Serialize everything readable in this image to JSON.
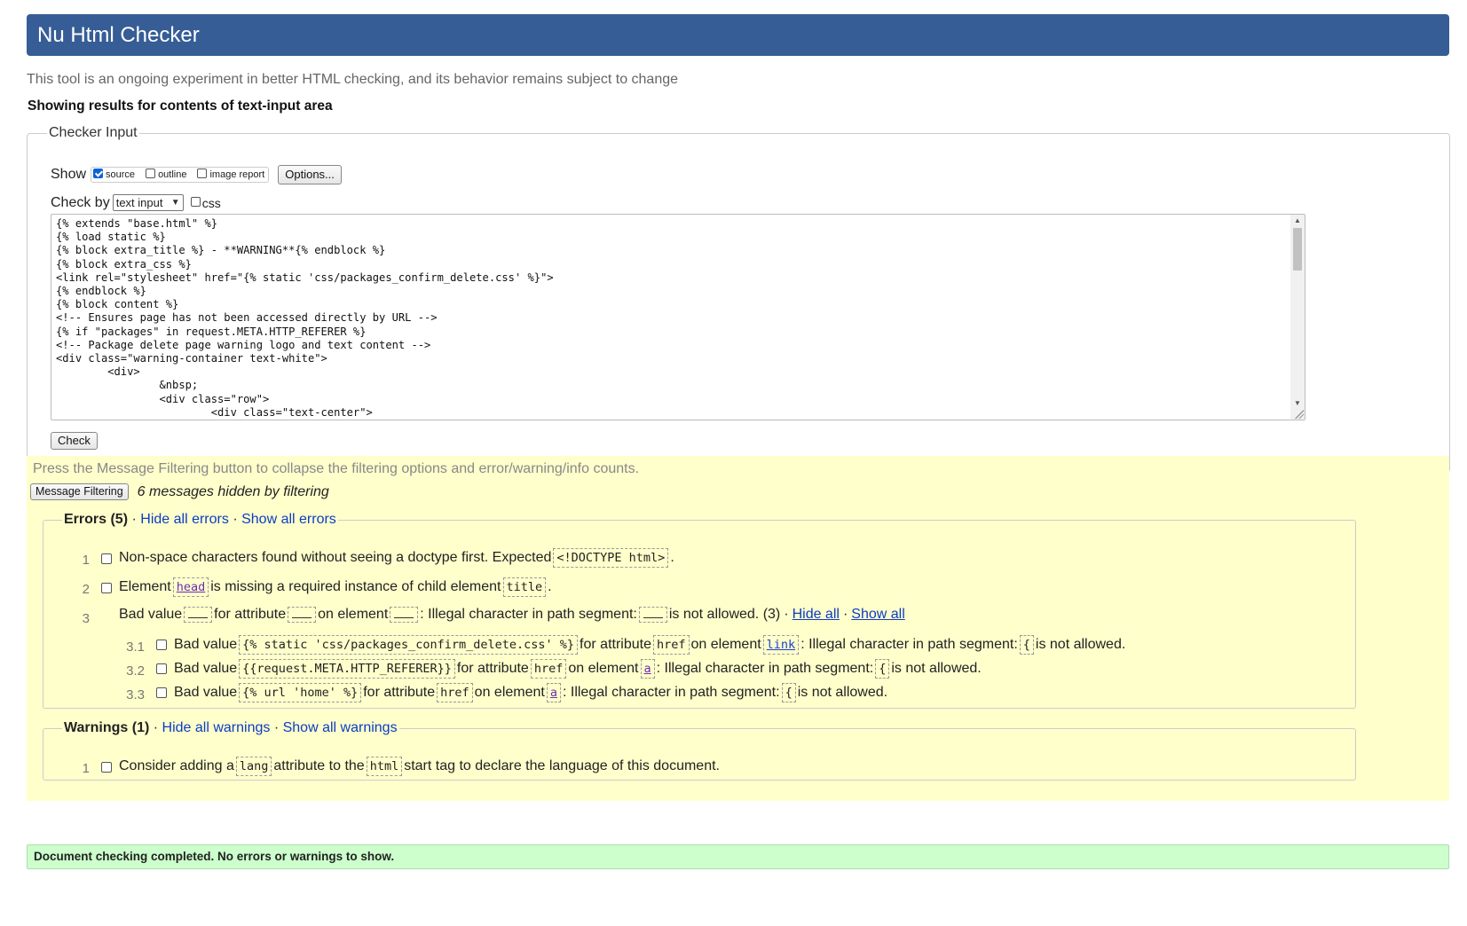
{
  "header": {
    "title": "Nu Html Checker"
  },
  "intro": "This tool is an ongoing experiment in better HTML checking, and its behavior remains subject to change",
  "showing": "Showing results for contents of text-input area",
  "checker_input": {
    "legend": "Checker Input",
    "show_label": "Show",
    "show_options": [
      "source",
      "outline",
      "image report"
    ],
    "options_button": "Options...",
    "check_by_label": "Check by",
    "check_by_value": "text input",
    "css_label": "css",
    "source_text": "{% extends \"base.html\" %}\n{% load static %}\n{% block extra_title %} - **WARNING**{% endblock %}\n{% block extra_css %}\n<link rel=\"stylesheet\" href=\"{% static 'css/packages_confirm_delete.css' %}\">\n{% endblock %}\n{% block content %}\n<!-- Ensures page has not been accessed directly by URL -->\n{% if \"packages\" in request.META.HTTP_REFERER %}\n<!-- Package delete page warning logo and text content -->\n<div class=\"warning-container text-white\">\n        <div>\n                &nbsp;\n                <div class=\"row\">\n                        <div class=\"text-center\">",
    "check_button": "Check"
  },
  "results": {
    "press_note": "Press the Message Filtering button to collapse the filtering options and error/warning/info counts.",
    "filter_button": "Message Filtering",
    "hidden_msg": "6 messages hidden by filtering",
    "errors": {
      "title": "Errors (5)",
      "sep": "·",
      "hide_all": "Hide all errors",
      "show_all": "Show all errors",
      "e1": {
        "num": "1",
        "text": "Non-space characters found without seeing a doctype first. Expected",
        "code": "<!DOCTYPE html>",
        "end": "."
      },
      "e2": {
        "num": "2",
        "t1": "Element",
        "code1": "head",
        "t2": "is missing a required instance of child element",
        "code2": "title",
        "end": "."
      },
      "e3": {
        "num": "3",
        "t1": "Bad value",
        "t2": "for attribute",
        "t3": "on element",
        "t4": ": Illegal character in path segment:",
        "t5": "is not allowed. (3)",
        "hide": "Hide all",
        "show": "Show all"
      },
      "sub": [
        {
          "num": "3.1",
          "value": "{% static 'css/packages_confirm_delete.css' %}",
          "attr": "href",
          "element": "link"
        },
        {
          "num": "3.2",
          "value": "{{request.META.HTTP_REFERER}}",
          "attr": "href",
          "element": "a"
        },
        {
          "num": "3.3",
          "value": "{% url 'home' %}",
          "attr": "href",
          "element": "a"
        }
      ],
      "sub_labels": {
        "bad": "Bad value",
        "for_attr": "for attribute",
        "on_el": "on element",
        "illegal": ": Illegal character in path segment:",
        "char": "{",
        "not_allowed": "is not allowed."
      }
    },
    "warnings": {
      "title": "Warnings (1)",
      "sep": "·",
      "hide_all": "Hide all warnings",
      "show_all": "Show all warnings",
      "w1": {
        "num": "1",
        "t1": "Consider adding a",
        "code1": "lang",
        "t2": "attribute to the",
        "code2": "html",
        "t3": "start tag to declare the language of this document."
      }
    }
  },
  "status": "Document checking completed. No errors or warnings to show."
}
